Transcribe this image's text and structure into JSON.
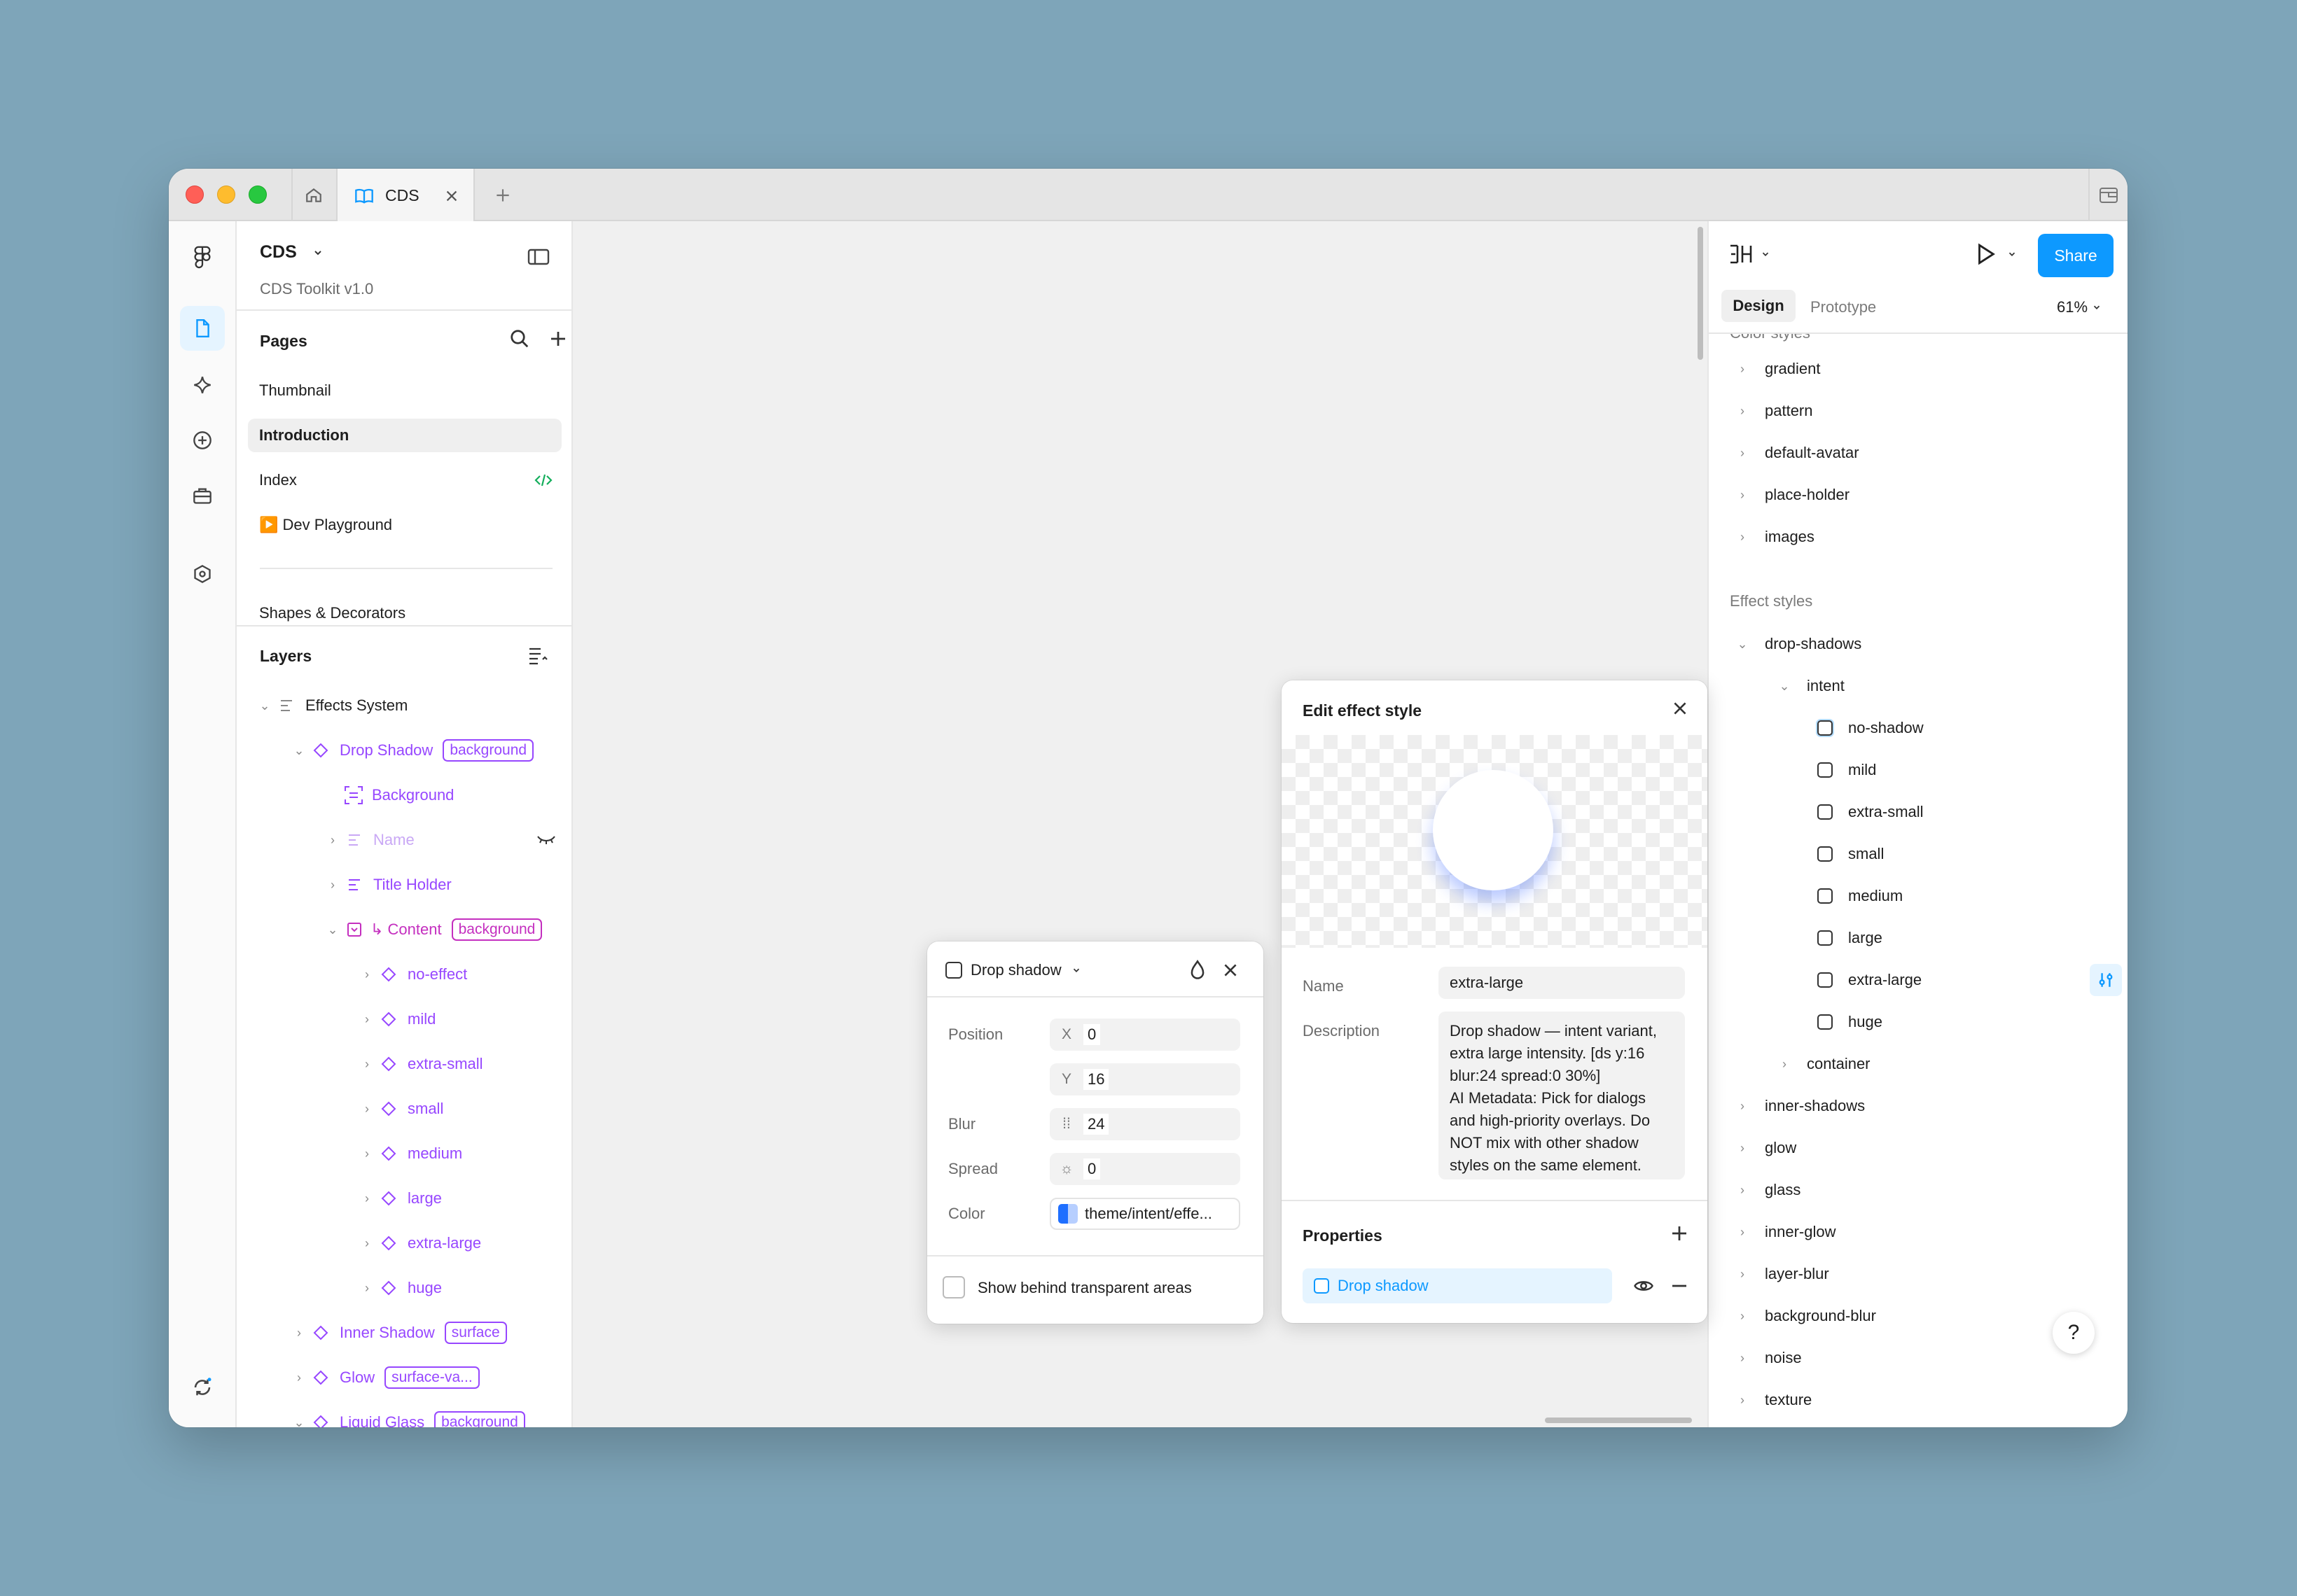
{
  "tabs": {
    "doc_title": "CDS"
  },
  "file": {
    "name": "CDS",
    "subtitle": "CDS Toolkit v1.0"
  },
  "pages": {
    "heading": "Pages",
    "items": [
      "Thumbnail",
      "Introduction",
      "Index",
      "▶️ Dev Playground",
      "Shapes & Decorators"
    ]
  },
  "layers": {
    "heading": "Layers",
    "items": [
      {
        "label": "Effects System"
      },
      {
        "label": "Drop Shadow",
        "badge": "background"
      },
      {
        "label": "Background"
      },
      {
        "label": "Name"
      },
      {
        "label": "Title Holder"
      },
      {
        "label": "↳ Content",
        "badge": "background"
      },
      {
        "label": "no-effect"
      },
      {
        "label": "mild"
      },
      {
        "label": "extra-small"
      },
      {
        "label": "small"
      },
      {
        "label": "medium"
      },
      {
        "label": "large"
      },
      {
        "label": "extra-large"
      },
      {
        "label": "huge"
      },
      {
        "label": "Inner Shadow",
        "badge": "surface"
      },
      {
        "label": "Glow",
        "badge": "surface-va..."
      },
      {
        "label": "Liquid Glass",
        "badge": "background"
      }
    ]
  },
  "right": {
    "share": "Share",
    "tab_design": "Design",
    "tab_prototype": "Prototype",
    "zoom": "61%",
    "color_styles_heading": "Color styles",
    "color_styles": [
      "gradient",
      "pattern",
      "default-avatar",
      "place-holder",
      "images"
    ],
    "effect_styles_heading": "Effect styles",
    "drop_shadows": "drop-shadows",
    "intent": "intent",
    "intent_items": [
      "no-shadow",
      "mild",
      "extra-small",
      "small",
      "medium",
      "large",
      "extra-large",
      "huge"
    ],
    "container": "container",
    "effect_groups": [
      "inner-shadows",
      "glow",
      "glass",
      "inner-glow",
      "layer-blur",
      "background-blur",
      "noise",
      "texture"
    ]
  },
  "shadow_panel": {
    "type": "Drop shadow",
    "position_label": "Position",
    "x_label": "X",
    "x": "0",
    "y_label": "Y",
    "y": "16",
    "blur_label": "Blur",
    "blur": "24",
    "spread_label": "Spread",
    "spread": "0",
    "color_label": "Color",
    "color": "theme/intent/effe...",
    "show_behind": "Show behind transparent areas"
  },
  "edit_panel": {
    "title": "Edit effect style",
    "name_label": "Name",
    "name": "extra-large",
    "description_label": "Description",
    "description": "Drop shadow — intent variant, extra large intensity. [ds y:16 blur:24 spread:0 30%]\nAI Metadata: Pick for dialogs and high-priority overlays. Do NOT mix with other shadow styles on the same element.",
    "properties_label": "Properties",
    "property": "Drop shadow"
  },
  "colors": {
    "accent": "#0d99ff",
    "purple": "#9747ff",
    "magenta": "#c42fbf",
    "background": "#7ea5b9"
  }
}
